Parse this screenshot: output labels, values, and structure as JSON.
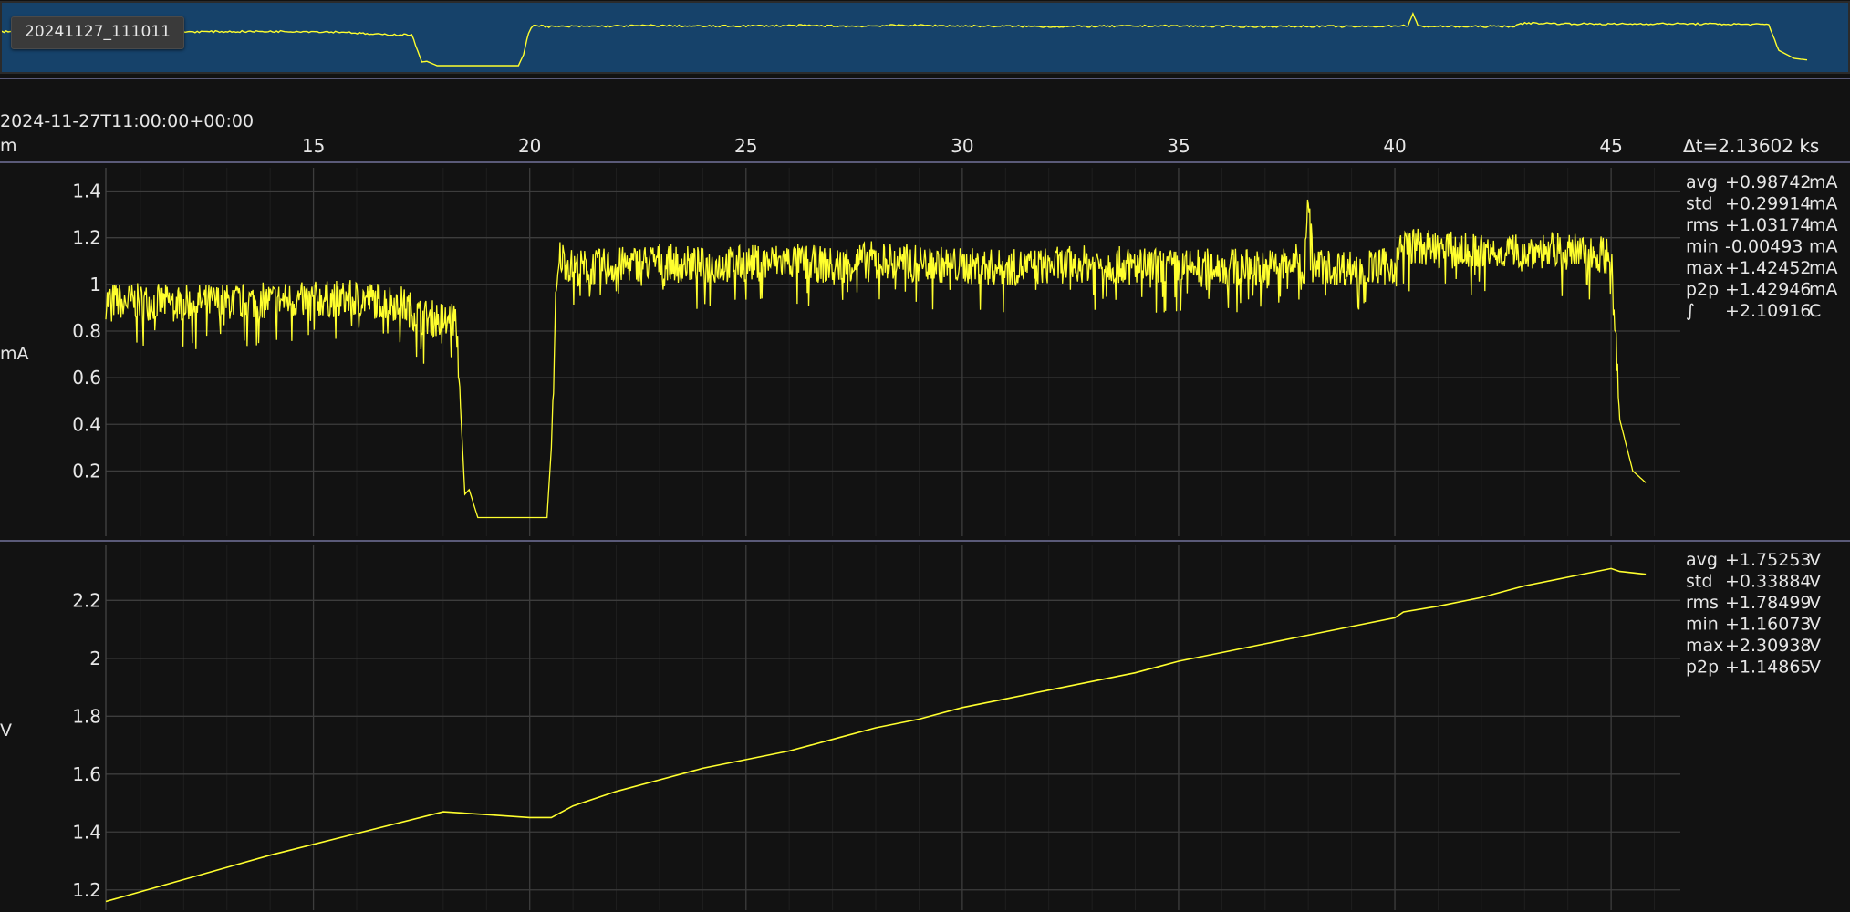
{
  "capture_label": "20241127_111011",
  "timestamp_origin": "2024-11-27T11:00:00+00:00",
  "time_unit": "m",
  "delta_t": "Δt=2.13602 ks",
  "colors": {
    "trace": "#ffff2e",
    "overview_bg": "#16426a",
    "background": "#121212",
    "grid": "#3d3d3d",
    "separator": "#5a5a78"
  },
  "chart_data": [
    {
      "type": "line",
      "title": "",
      "xlabel": "m",
      "ylabel": "mA",
      "xlim": [
        10.2,
        46.6
      ],
      "x_ticks": [
        15,
        20,
        25,
        30,
        35,
        40,
        45
      ],
      "y_ticks": [
        0.2,
        0.4,
        0.6,
        0.8,
        1,
        1.2,
        1.4
      ],
      "ylim": [
        -0.08,
        1.5
      ],
      "grid": true,
      "series": [
        {
          "x": [
            10.2,
            12,
            14,
            16,
            17.0,
            17.5,
            18.0,
            18.3,
            18.5,
            18.6,
            18.8,
            19.0,
            19.5,
            20.0,
            20.4,
            20.5,
            20.6,
            20.7,
            21,
            22,
            23,
            24,
            25,
            26,
            27,
            28,
            29,
            30,
            31,
            32,
            33,
            34,
            35,
            36,
            37,
            37.9,
            38.0,
            38.1,
            39,
            40.0,
            40.2,
            41,
            42,
            43,
            44,
            44.8,
            45.0,
            45.2,
            45.5,
            45.8
          ],
          "values": [
            0.93,
            0.92,
            0.93,
            0.94,
            0.92,
            0.86,
            0.85,
            0.85,
            0.1,
            0.12,
            0.0,
            0.0,
            0.0,
            0.0,
            0.0,
            0.3,
            0.9,
            1.12,
            1.07,
            1.08,
            1.1,
            1.08,
            1.09,
            1.1,
            1.08,
            1.11,
            1.09,
            1.08,
            1.07,
            1.08,
            1.09,
            1.08,
            1.07,
            1.08,
            1.07,
            1.1,
            1.42,
            1.08,
            1.07,
            1.08,
            1.17,
            1.15,
            1.14,
            1.15,
            1.14,
            1.13,
            1.12,
            0.42,
            0.2,
            0.15
          ]
        }
      ],
      "stats": [
        {
          "name": "avg",
          "value": "+0.98742",
          "unit": "mA"
        },
        {
          "name": "std",
          "value": "+0.29914",
          "unit": "mA"
        },
        {
          "name": "rms",
          "value": "+1.03174",
          "unit": "mA"
        },
        {
          "name": "min",
          "value": "-0.00493",
          "unit": "mA"
        },
        {
          "name": "max",
          "value": "+1.42452",
          "unit": "mA"
        },
        {
          "name": "p2p",
          "value": "+1.42946",
          "unit": "mA"
        },
        {
          "name": "∫",
          "value": "+2.10916",
          "unit": "C"
        }
      ]
    },
    {
      "type": "line",
      "title": "",
      "xlabel": "m",
      "ylabel": "V",
      "xlim": [
        10.2,
        46.6
      ],
      "x_ticks": [
        15,
        20,
        25,
        30,
        35,
        40,
        45
      ],
      "y_ticks": [
        1.2,
        1.4,
        1.6,
        1.8,
        2,
        2.2
      ],
      "ylim": [
        1.13,
        2.39
      ],
      "grid": true,
      "series": [
        {
          "x": [
            10.2,
            14,
            18.0,
            19,
            20.0,
            20.5,
            21,
            22,
            23,
            24,
            25,
            26,
            27,
            28,
            29,
            30,
            31,
            32,
            33,
            34,
            35,
            36,
            37,
            38,
            39,
            40.0,
            40.2,
            41,
            42,
            43,
            44,
            45.0,
            45.2,
            45.8
          ],
          "values": [
            1.16,
            1.32,
            1.47,
            1.46,
            1.45,
            1.45,
            1.49,
            1.54,
            1.58,
            1.62,
            1.65,
            1.68,
            1.72,
            1.76,
            1.79,
            1.83,
            1.86,
            1.89,
            1.92,
            1.95,
            1.99,
            2.02,
            2.05,
            2.08,
            2.11,
            2.14,
            2.16,
            2.18,
            2.21,
            2.25,
            2.28,
            2.31,
            2.3,
            2.29
          ]
        }
      ],
      "stats": [
        {
          "name": "avg",
          "value": "+1.75253",
          "unit": "V"
        },
        {
          "name": "std",
          "value": "+0.33884",
          "unit": "V"
        },
        {
          "name": "rms",
          "value": "+1.78499",
          "unit": "V"
        },
        {
          "name": "min",
          "value": "+1.16073",
          "unit": "V"
        },
        {
          "name": "max",
          "value": "+2.30938",
          "unit": "V"
        },
        {
          "name": "p2p",
          "value": "+1.14865",
          "unit": "V"
        }
      ]
    }
  ]
}
